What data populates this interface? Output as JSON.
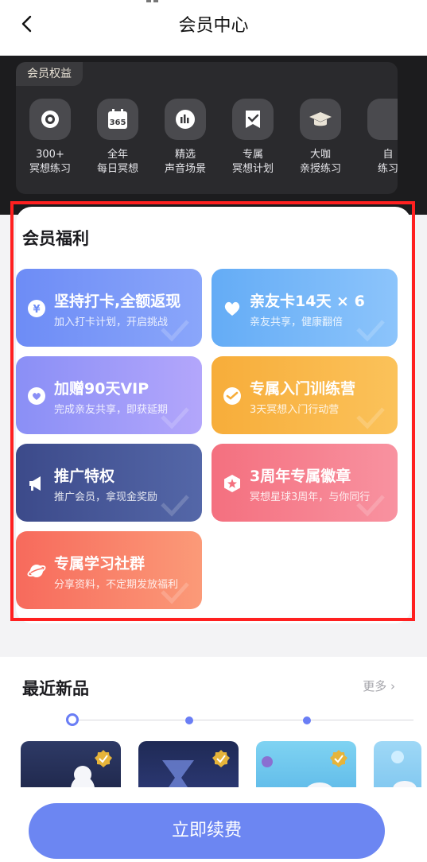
{
  "header": {
    "title": "会员中心"
  },
  "rights": {
    "tag": "会员权益",
    "items": [
      {
        "line1": "300+",
        "line2": "冥想练习",
        "icon": "circle-target-icon"
      },
      {
        "line1": "全年",
        "line2": "每日冥想",
        "icon": "calendar-365-icon"
      },
      {
        "line1": "精选",
        "line2": "声音场景",
        "icon": "sound-bars-icon"
      },
      {
        "line1": "专属",
        "line2": "冥想计划",
        "icon": "bookmark-check-icon"
      },
      {
        "line1": "大咖",
        "line2": "亲授练习",
        "icon": "graduation-cap-icon"
      },
      {
        "line1": "自",
        "line2": "练习",
        "icon": "more-icon"
      }
    ]
  },
  "benefits": {
    "title": "会员福利",
    "items": [
      {
        "title": "坚持打卡,全额返现",
        "subtitle": "加入打卡计划，开启挑战",
        "icon": "yuan-coin-icon"
      },
      {
        "title": "亲友卡14天 × 6",
        "subtitle": "亲友共享，健康翻倍",
        "icon": "heart-hand-icon"
      },
      {
        "title": "加赠90天VIP",
        "subtitle": "完成亲友共享，即获延期",
        "icon": "heart-badge-icon"
      },
      {
        "title": "专属入门训练营",
        "subtitle": "3天冥想入门行动营",
        "icon": "trend-check-icon"
      },
      {
        "title": "推广特权",
        "subtitle": "推广会员，拿现金奖励",
        "icon": "megaphone-icon"
      },
      {
        "title": "3周年专属徽章",
        "subtitle": "冥想星球3周年，与你同行",
        "icon": "star-hexagon-icon"
      },
      {
        "title": "专属学习社群",
        "subtitle": "分享资料，不定期发放福利",
        "icon": "planet-icon"
      }
    ]
  },
  "recent": {
    "title": "最近新品",
    "more": "更多"
  },
  "cta": {
    "label": "立即续费"
  },
  "colors": {
    "accent": "#6c86f2",
    "frame": "#ff2020"
  }
}
